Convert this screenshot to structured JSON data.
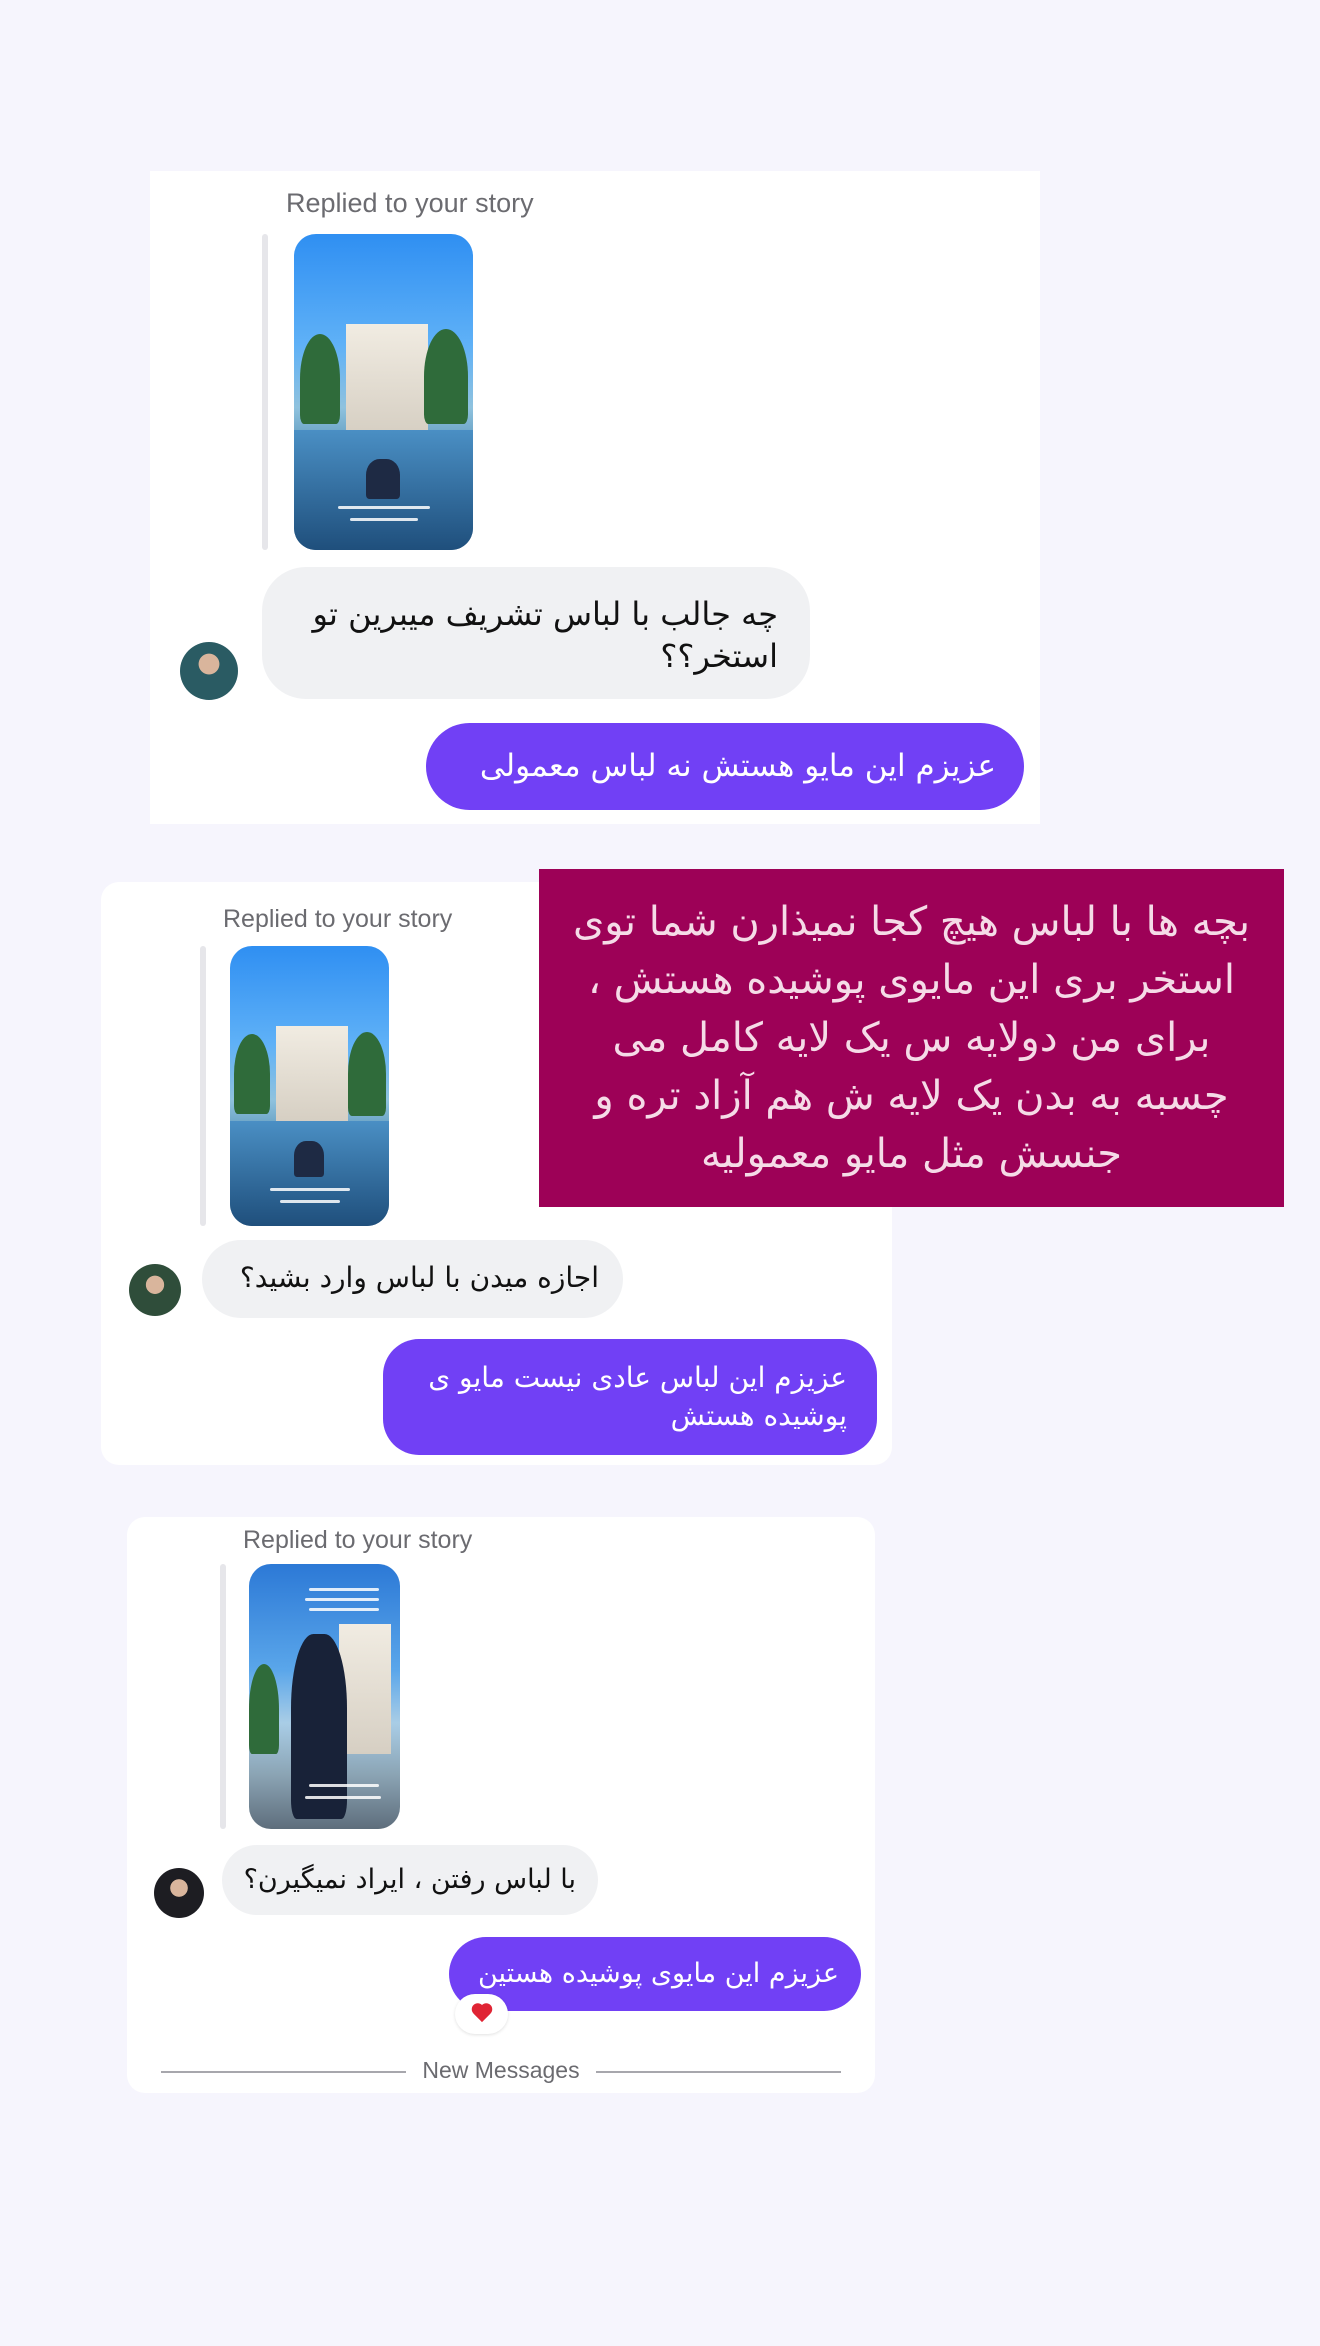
{
  "threads": [
    {
      "replied_label": "Replied to your story",
      "incoming": "چه جالب با لباس تشریف میبرین تو استخر؟؟",
      "outgoing": "عزیزم این مایو هستش نه لباس معمولی"
    },
    {
      "replied_label": "Replied to your story",
      "incoming": "اجازه میدن با لباس وارد بشید؟",
      "outgoing": "عزیزم این لباس عادی نیست مایو ی پوشیده هستش"
    },
    {
      "replied_label": "Replied to your story",
      "incoming": "با لباس رفتن ، ایراد نمیگیرن؟",
      "outgoing": "عزیزم این مایوی پوشیده هستین",
      "reaction": "heart-icon"
    }
  ],
  "overlay_note": "بچه ها با لباس هیچ کجا نمیذارن شما توی استخر بری این مایوی پوشیده هستش ، برای من دولایه س یک لایه کامل می چسبه به بدن یک لایه ش هم آزاد تره و جنسش مثل مایو معمولیه",
  "divider": {
    "label": "New Messages"
  },
  "colors": {
    "background": "#f6f5fd",
    "outgoing_bubble": "#7140f5",
    "incoming_bubble": "#f0f1f3",
    "overlay": "#9d0157"
  }
}
